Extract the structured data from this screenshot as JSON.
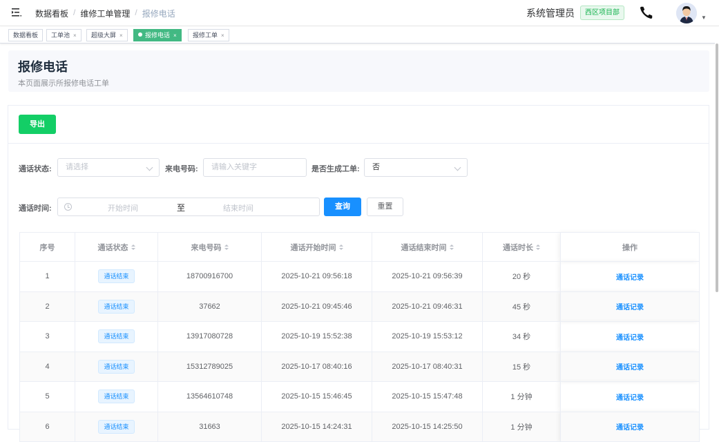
{
  "header": {
    "breadcrumb": [
      "数据看板",
      "维修工单管理",
      "报修电话"
    ],
    "user_role": "系统管理员",
    "project_badge": "西区项目部"
  },
  "tabs": [
    {
      "label": "数据看板",
      "closable": false,
      "active": false
    },
    {
      "label": "工单池",
      "closable": true,
      "active": false
    },
    {
      "label": "超级大屏",
      "closable": true,
      "active": false
    },
    {
      "label": "报修电话",
      "closable": true,
      "active": true
    },
    {
      "label": "报修工单",
      "closable": true,
      "active": false
    }
  ],
  "page": {
    "title": "报修电话",
    "description": "本页面展示所报修电话工单"
  },
  "toolbar": {
    "export_label": "导出"
  },
  "filters": {
    "status_label": "通话状态:",
    "status_placeholder": "请选择",
    "phone_label": "来电号码:",
    "phone_placeholder": "请输入关键字",
    "generated_label": "是否生成工单:",
    "generated_value": "否",
    "time_label": "通话时间:",
    "start_placeholder": "开始时间",
    "range_separator": "至",
    "end_placeholder": "结束时间",
    "query_label": "查询",
    "reset_label": "重置"
  },
  "table": {
    "columns": [
      "序号",
      "通话状态",
      "来电号码",
      "通话开始时间",
      "通话结束时间",
      "通话时长",
      "操作"
    ],
    "rows": [
      {
        "index": "1",
        "status": "通话结束",
        "phone": "18700916700",
        "start": "2025-10-21 09:56:18",
        "end": "2025-10-21 09:56:39",
        "duration": "20 秒",
        "action": "通话记录"
      },
      {
        "index": "2",
        "status": "通话结束",
        "phone": "37662",
        "start": "2025-10-21 09:45:46",
        "end": "2025-10-21 09:46:31",
        "duration": "45 秒",
        "action": "通话记录"
      },
      {
        "index": "3",
        "status": "通话结束",
        "phone": "13917080728",
        "start": "2025-10-19 15:52:38",
        "end": "2025-10-19 15:53:12",
        "duration": "34 秒",
        "action": "通话记录"
      },
      {
        "index": "4",
        "status": "通话结束",
        "phone": "15312789025",
        "start": "2025-10-17 08:40:16",
        "end": "2025-10-17 08:40:31",
        "duration": "15 秒",
        "action": "通话记录"
      },
      {
        "index": "5",
        "status": "通话结束",
        "phone": "13564610748",
        "start": "2025-10-15 15:46:45",
        "end": "2025-10-15 15:47:48",
        "duration": "1 分钟",
        "action": "通话记录"
      },
      {
        "index": "6",
        "status": "通话结束",
        "phone": "31663",
        "start": "2025-10-15 14:24:31",
        "end": "2025-10-15 14:25:50",
        "duration": "1 分钟",
        "action": "通话记录"
      }
    ]
  },
  "colors": {
    "primary": "#1890ff",
    "success": "#13ce66",
    "active_tag": "#42b983"
  }
}
